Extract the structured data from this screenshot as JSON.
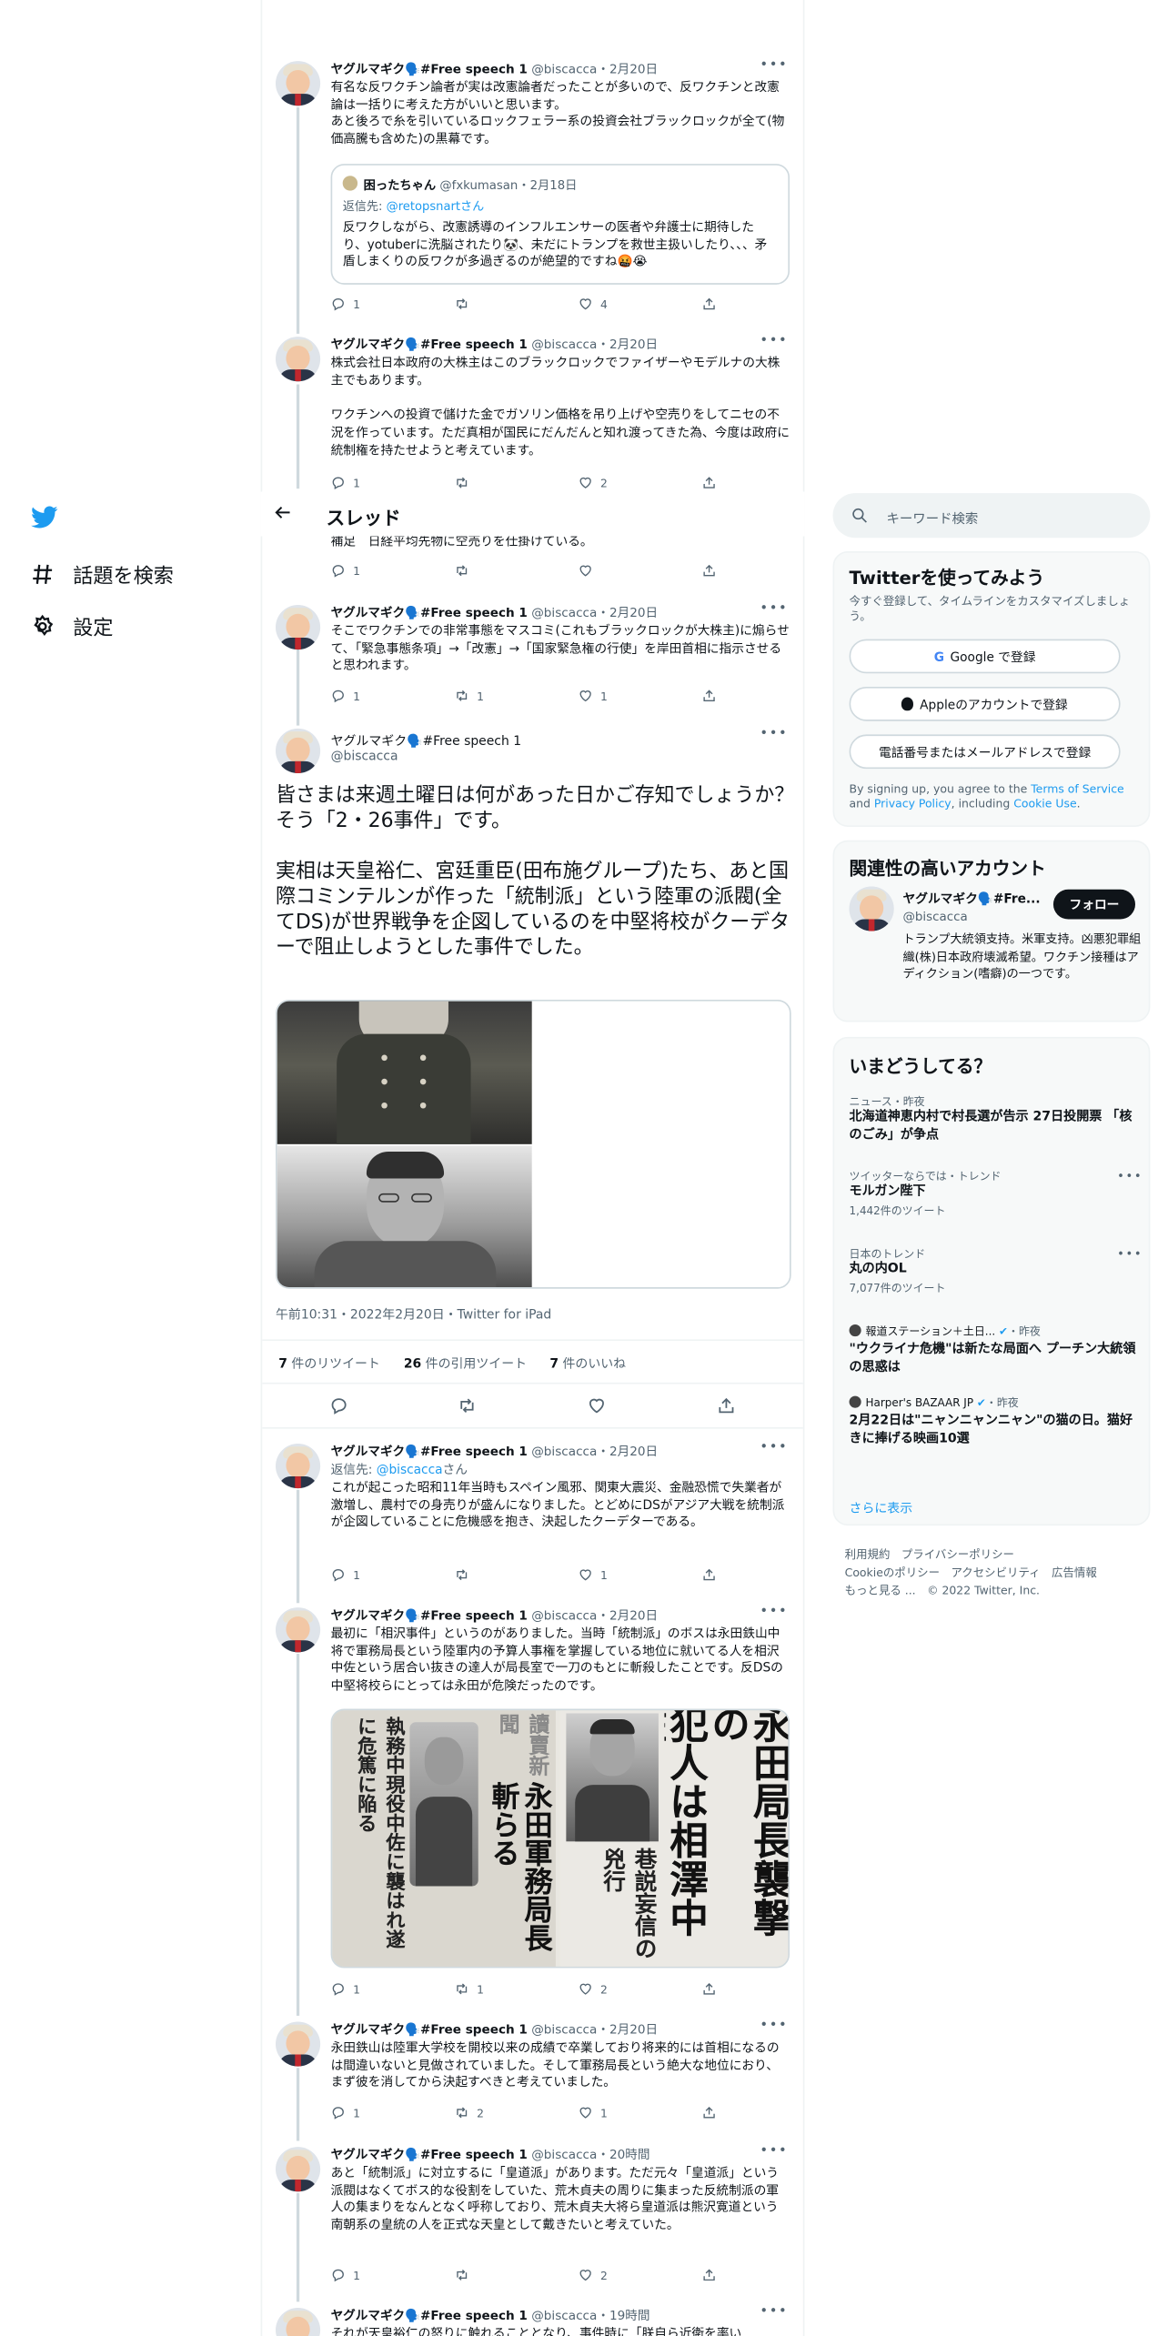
{
  "nav": {
    "items": [
      {
        "label": "話題を検索",
        "icon": "hashtag-icon"
      },
      {
        "label": "設定",
        "icon": "gear-icon"
      }
    ]
  },
  "header": {
    "title": "スレッド"
  },
  "author": {
    "name": "ヤグルマギク🗣️#Free speech 1",
    "handle": "@biscacca"
  },
  "tweets_above": [
    {
      "date": "2月20日",
      "text": "有名な反ワクチン論者が実は改憲論者だったことが多いので、反ワクチンと改憲論は一括りに考えた方がいいと思います。\nあと後ろで糸を引いているロックフェラー系の投資会社ブラックロックが全て(物価高騰も含めた)の黒幕です。",
      "quote": {
        "name": "困ったちゃん",
        "handle": "@fxkumasan",
        "date": "2月18日",
        "reply_prefix": "返信先: ",
        "reply_to": "@retopsnartさん",
        "text": "反ワクしながら、改憲誘導のインフルエンサーの医者や弁護士に期待したり、yotuberに洗脳されたり🐼、未だにトランプを救世主扱いしたり、、、矛盾しまくりの反ワクが多過ぎるのが絶望的ですね🤬😭"
      },
      "counts": {
        "reply": "1",
        "retweet": "",
        "like": "4"
      }
    },
    {
      "date": "2月20日",
      "text": "株式会社日本政府の大株主はこのブラックロックでファイザーやモデルナの大株主でもあります。\n\nワクチンへの投資で儲けた金でガソリン価格を吊り上げや空売りをしてニセの不況を作っています。ただ真相が国民にだんだんと知れ渡ってきた為、今度は政府に統制権を持たせようと考えています。",
      "counts": {
        "reply": "1",
        "retweet": "",
        "like": "2"
      }
    },
    {
      "date": "",
      "text": "補足　日経平均先物に空売りを仕掛けている。",
      "counts": {
        "reply": "1",
        "retweet": "",
        "like": ""
      }
    },
    {
      "date": "2月20日",
      "text": "そこでワクチンでの非常事態をマスコミ(これもブラックロックが大株主)に煽らせて、「緊急事態条項」→「改憲」→「国家緊急権の行使」を岸田首相に指示させると思われます。",
      "counts": {
        "reply": "1",
        "retweet": "1",
        "like": "1"
      }
    }
  ],
  "focused": {
    "text": "皆さまは来週土曜日は何があった日かご存知でしょうか？\nそう「2・26事件」です。\n\n実相は天皇裕仁、宮廷重臣(田布施グループ)たち、あと国際コミンテルンが作った「統制派」という陸軍の派閥(全てDS)が世界戦争を企図しているのを中堅将校がクーデターで阻止しようとした事件でした。",
    "timestamp": "午前10:31・2022年2月20日・Twitter for iPad",
    "stats": {
      "retweets_num": "7",
      "retweets_label": " 件のリツイート",
      "quotes_num": "26",
      "quotes_label": " 件の引用ツイート",
      "likes_num": "7",
      "likes_label": " 件のいいね"
    }
  },
  "tweets_below": [
    {
      "date": "2月20日",
      "reply_prefix": "返信先: ",
      "reply_to": "@biscacca",
      "reply_suffix": "さん",
      "text": "これが起こった昭和11年当時もスペイン風邪、関東大震災、金融恐慌で失業者が激増し、農村での身売りが盛んになりました。とどめにDSがアジア大戦を統制派が企図していることに危機感を抱き、決起したクーデターである。",
      "counts": {
        "reply": "1",
        "retweet": "",
        "like": "1"
      }
    },
    {
      "date": "2月20日",
      "text": "最初に「相沢事件」というのがありました。当時「統制派」のボスは永田鉄山中将で軍務局長という陸軍内の予算人事権を掌握している地位に就いてる人を相沢中佐という居合い抜きの達人が局長室で一刀のもとに斬殺したことです。反DSの中堅将校らにとっては永田が危険だったのです。",
      "newspaper": {
        "masthead": "讀賣新聞",
        "headline1": "永田軍務局長斬らる",
        "headline2": "執務中現役中佐に襲はれ遂に危篤に陥る",
        "big1": "永田局長襲撃の",
        "big2": "犯人は相澤中佐",
        "big3": "巷説妄信の兇行"
      },
      "counts": {
        "reply": "1",
        "retweet": "1",
        "like": "2"
      }
    },
    {
      "date": "2月20日",
      "text": "永田鉄山は陸軍大学校を開校以来の成績で卒業しており将来的には首相になるのは間違いないと見做されていました。そして軍務局長という絶大な地位におり、まず彼を消してから決起すべきと考えていました。",
      "counts": {
        "reply": "1",
        "retweet": "2",
        "like": "1"
      }
    },
    {
      "date": "20時間",
      "text": "あと「統制派」に対立するに「皇道派」があります。ただ元々「皇道派」という派閥はなくてボス的な役割をしていた、荒木貞夫の周りに集まった反統制派の軍人の集まりをなんとなく呼称しており、荒木貞夫大将ら皇道派は熊沢寛道という南朝系の皇統の人を正式な天皇として戴きたいと考えていた。",
      "counts": {
        "reply": "1",
        "retweet": "",
        "like": "2"
      }
    },
    {
      "date": "19時間",
      "text": "それが天皇裕仁の怒りに触れることとなり、事件時に「朕自ら近衛を率い",
      "counts": {
        "reply": "",
        "retweet": "",
        "like": ""
      }
    }
  ],
  "sidebar": {
    "search_placeholder": "キーワード検索",
    "signup": {
      "title": "Twitterを使ってみよう",
      "desc": "今すぐ登録して、タイムラインをカスタマイズしましょう。",
      "google": "Google で登録",
      "apple": "Appleのアカウントで登録",
      "phone": "電話番号またはメールアドレスで登録",
      "terms_1": "By signing up, you agree to the ",
      "terms_tos": "Terms of Service",
      "terms_2": " and ",
      "terms_pp": "Privacy Policy",
      "terms_3": ", including ",
      "terms_cookie": "Cookie Use",
      "terms_4": "."
    },
    "related": {
      "title": "関連性の高いアカウント",
      "name": "ヤグルマギク🗣️#Fre...",
      "handle": "@biscacca",
      "follow": "フォロー",
      "bio": "トランプ大統領支持。米軍支持。凶悪犯罪組織(株)日本政府壊滅希望。ワクチン接種はアディクション(嗜癖)の一つです。"
    },
    "trends": {
      "title": "いまどうしてる？",
      "items": [
        {
          "context": "ニュース・昨夜",
          "name": "北海道神恵内村で村長選が告示 27日投開票 「核のごみ」が争点",
          "count": ""
        },
        {
          "context": "ツイッターならでは・トレンド",
          "name": "モルガン陛下",
          "count": "1,442件のツイート"
        },
        {
          "context": "日本のトレンド",
          "name": "丸の内OL",
          "count": "7,077件のツイート"
        },
        {
          "context": "報道ステーション＋土日...",
          "suffix": "・昨夜",
          "name": "\"ウクライナ危機\"は新たな局面へ プーチン大統領の思惑は",
          "count": ""
        },
        {
          "context": "Harper's BAZAAR JP",
          "suffix": "・昨夜",
          "name": "2月22日は\"ニャンニャンニャン\"の猫の日。猫好きに捧げる映画10選",
          "count": ""
        }
      ],
      "show_more": "さらに表示"
    },
    "footer": {
      "l1": "利用規約　プライバシーポリシー",
      "l2": "Cookieのポリシー　アクセシビリティ　広告情報",
      "l3": "もっと見る ...　© 2022 Twitter, Inc."
    }
  },
  "colors": {
    "accent": "#1d9bf0",
    "text": "#0f1419",
    "muted": "#536471",
    "border": "#cfd9de"
  }
}
